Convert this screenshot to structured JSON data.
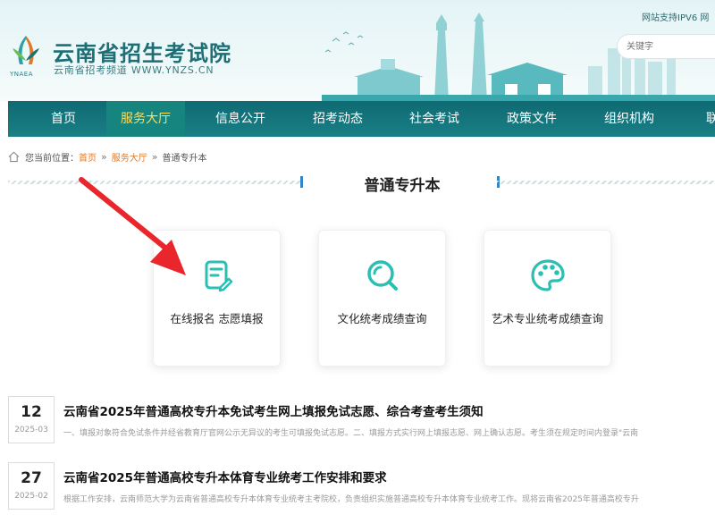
{
  "header": {
    "title": "云南省招生考试院",
    "subtitle": "云南省招考频道 WWW.YNZS.CN",
    "logo_text": "YNAEA",
    "ipv6": "网站支持IPV6 网",
    "search_placeholder": "关键字"
  },
  "nav": {
    "items": [
      {
        "label": "首页"
      },
      {
        "label": "服务大厅"
      },
      {
        "label": "信息公开"
      },
      {
        "label": "招考动态"
      },
      {
        "label": "社会考试"
      },
      {
        "label": "政策文件"
      },
      {
        "label": "组织机构"
      },
      {
        "label": "联"
      }
    ],
    "active_index": 1
  },
  "breadcrumb": {
    "prefix": "您当前位置：",
    "items": [
      "首页",
      "服务大厅",
      "普通专升本"
    ],
    "separator": "»"
  },
  "section": {
    "title": "普通专升本"
  },
  "cards": [
    {
      "label": "在线报名 志愿填报",
      "icon": "form-edit-icon"
    },
    {
      "label": "文化统考成绩查询",
      "icon": "search-icon"
    },
    {
      "label": "艺术专业统考成绩查询",
      "icon": "palette-icon"
    }
  ],
  "news": [
    {
      "day": "12",
      "year_month": "2025-03",
      "title": "云南省2025年普通高校专升本免试考生网上填报免试志愿、综合考查考生须知",
      "summary": "一、填报对象符合免试条件并经省教育厅官网公示无异议的考生可填报免试志愿。二、填报方式实行网上填报志愿、网上确认志愿。考生须在规定时间内登录\"云南"
    },
    {
      "day": "27",
      "year_month": "2025-02",
      "title": "云南省2025年普通高校专升本体育专业统考工作安排和要求",
      "summary": "根据工作安排，云南师范大学为云南省普通高校专升本体育专业统考主考院校，负责组织实施普通高校专升本体育专业统考工作。现将云南省2025年普通高校专升"
    }
  ],
  "colors": {
    "brand": "#1d6f75",
    "nav_bg": "#0f6a72",
    "nav_active_text": "#ffde5a",
    "breadcrumb_link": "#e07a2a",
    "icon_accent": "#2bbfb3",
    "arrow": "#e8262c"
  }
}
